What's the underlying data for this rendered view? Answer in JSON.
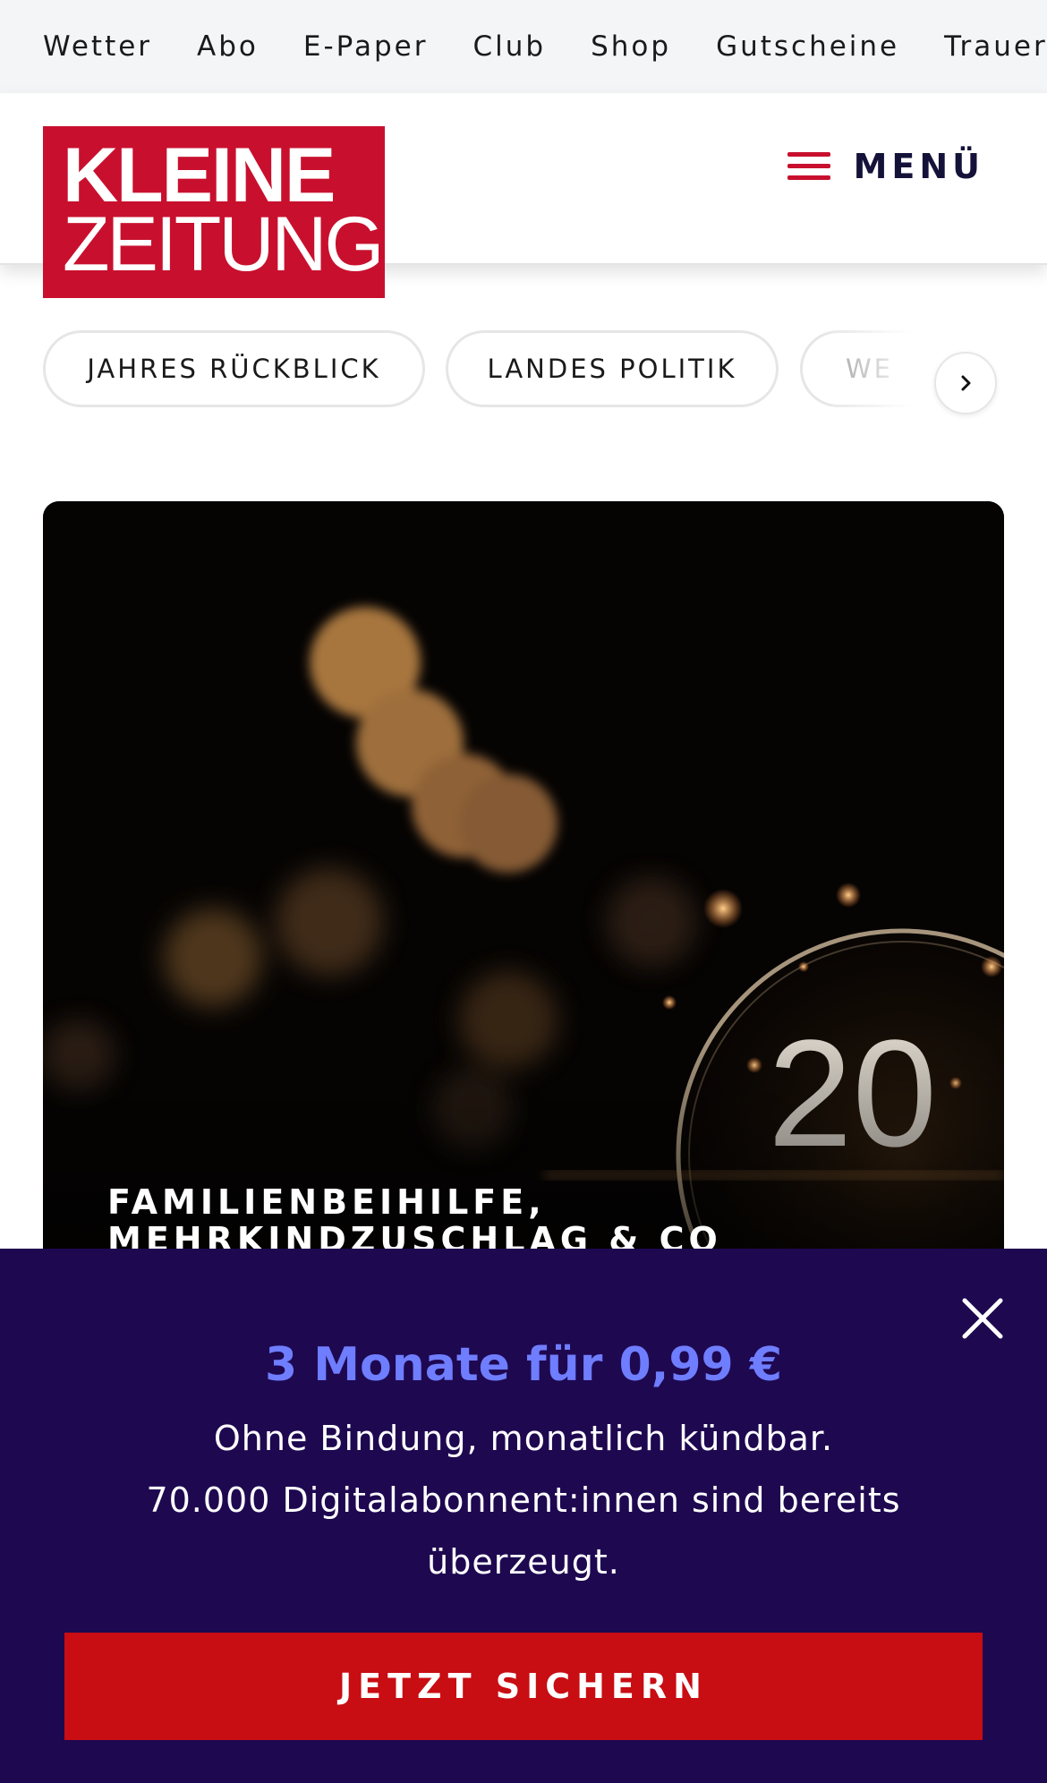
{
  "topnav": {
    "items": [
      "Wetter",
      "Abo",
      "E-Paper",
      "Club",
      "Shop",
      "Gutscheine",
      "Trauerportal"
    ]
  },
  "header": {
    "logo_line1": "KLEINE",
    "logo_line2": "ZEITUNG",
    "menu_label": "MENÜ"
  },
  "categories": {
    "items": [
      "JAHRES RÜCKBLICK",
      "LANDES POLITIK",
      "WE"
    ]
  },
  "hero": {
    "title": "FAMILIENBEIHILFE, MEHRKINDZUSCHLAG & CO",
    "image_text": "20"
  },
  "promo": {
    "headline": "3 Monate für 0,99 €",
    "line1": "Ohne Bindung, monatlich kündbar.",
    "line2": "70.000 Digitalabonnent:innen sind bereits überzeugt.",
    "cta_label": "JETZT SICHERN"
  },
  "colors": {
    "brand_red": "#c8102e",
    "promo_bg": "#1e0850",
    "promo_accent": "#6f7dff",
    "cta_bg": "#c80d13"
  }
}
